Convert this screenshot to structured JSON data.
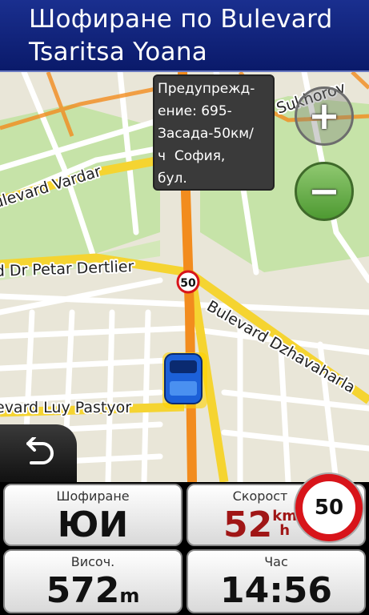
{
  "header": {
    "line1": "Шофиране по Bulevard",
    "line2": "Tsaritsa Yoana"
  },
  "map": {
    "tooltip": "Предупрежд-\nение: 695-\nЗасада-50км/\nч  София,\nбул.",
    "speed_limit_marker": "50",
    "streets": {
      "vardar": "ulevard Vardar",
      "dertlier": "d Dr Petar Dertlier",
      "dzhavaharlal": "Bulevard Dzhavaharla",
      "luy_pastyor": "evard Luy Pastyor",
      "sukhodolsko": "Sukhorov"
    },
    "zoom_in_label": "+",
    "zoom_out_label": "−"
  },
  "panels": {
    "driving": {
      "label": "Шофиране",
      "value": "ЮИ"
    },
    "speed": {
      "label": "Скорост",
      "value": "52",
      "unit_top": "km",
      "unit_bottom": "h"
    },
    "altitude": {
      "label": "Височ.",
      "value": "572",
      "unit": "m"
    },
    "time": {
      "label": "Час",
      "value": "14:56"
    }
  },
  "speed_limit_sign": "50",
  "colors": {
    "header_bg": "#1a2f8f",
    "route": "#f28c1e",
    "speed_text": "#a01616",
    "limit_ring": "#d8141a"
  }
}
